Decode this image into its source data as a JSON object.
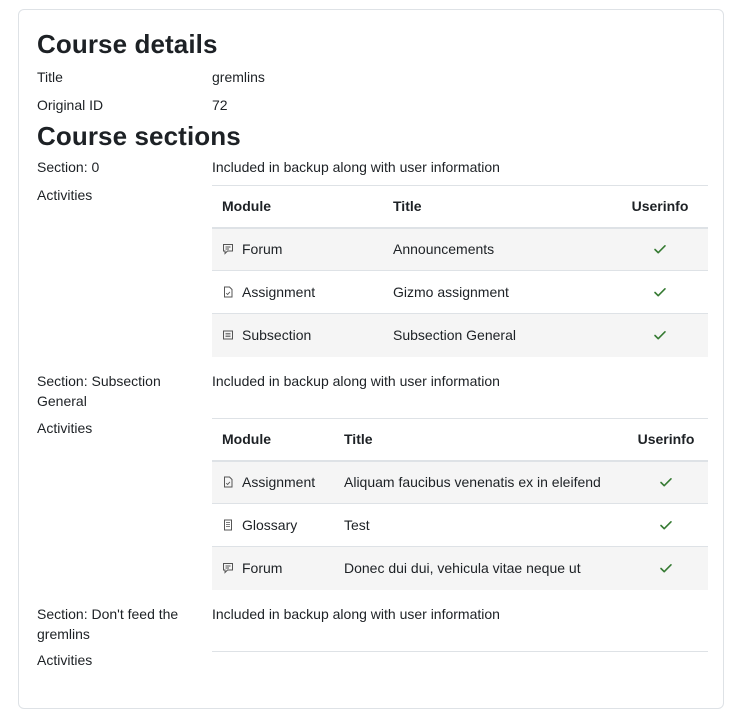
{
  "course_details": {
    "heading": "Course details",
    "title_label": "Title",
    "title_value": "gremlins",
    "original_id_label": "Original ID",
    "original_id_value": "72"
  },
  "course_sections": {
    "heading": "Course sections",
    "sections": [
      {
        "label": "Section: 0",
        "status": "Included in backup along with user information",
        "activities_label": "Activities",
        "columns": [
          "Module",
          "Title",
          "Userinfo"
        ],
        "rows": [
          {
            "icon": "forum-icon",
            "module": "Forum",
            "title": "Announcements",
            "userinfo": true
          },
          {
            "icon": "assignment-icon",
            "module": "Assignment",
            "title": "Gizmo assignment",
            "userinfo": true
          },
          {
            "icon": "subsection-icon",
            "module": "Subsection",
            "title": "Subsection General",
            "userinfo": true
          }
        ]
      },
      {
        "label": "Section: Subsection General",
        "status": "Included in backup along with user information",
        "activities_label": "Activities",
        "columns": [
          "Module",
          "Title",
          "Userinfo"
        ],
        "rows": [
          {
            "icon": "assignment-icon",
            "module": "Assignment",
            "title": "Aliquam faucibus venenatis ex in eleifend",
            "userinfo": true
          },
          {
            "icon": "glossary-icon",
            "module": "Glossary",
            "title": "Test",
            "userinfo": true
          },
          {
            "icon": "forum-icon",
            "module": "Forum",
            "title": "Donec dui dui, vehicula vitae neque ut",
            "userinfo": true
          }
        ]
      },
      {
        "label": "Section: Don't feed the gremlins",
        "status": "Included in backup along with user information",
        "activities_label": "Activities"
      }
    ]
  },
  "colors": {
    "check": "#357a32",
    "row_stripe": "#f5f5f5",
    "border": "#dee2e6"
  }
}
